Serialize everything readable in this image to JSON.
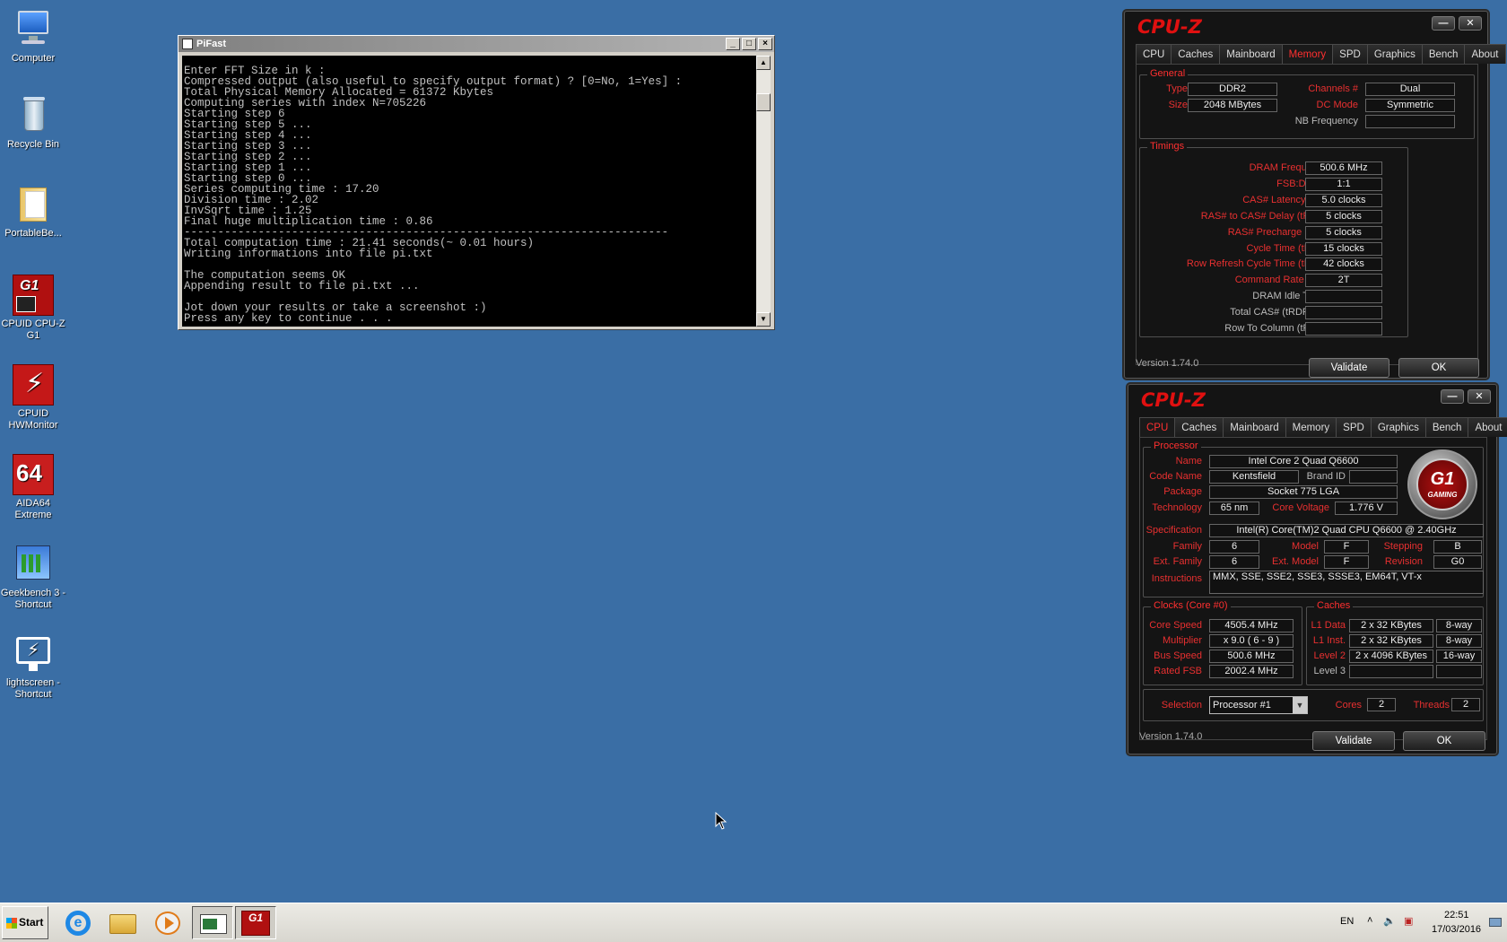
{
  "desktop": {
    "icons": [
      {
        "label": "Computer",
        "icon": "computer-icon"
      },
      {
        "label": "Recycle Bin",
        "icon": "recycle-bin-icon"
      },
      {
        "label": "PortableBe...",
        "icon": "folder-icon"
      },
      {
        "label": "CPUID CPU-Z G1",
        "icon": "cpuz-g1-icon"
      },
      {
        "label": "CPUID HWMonitor",
        "icon": "hwmonitor-icon"
      },
      {
        "label": "AIDA64 Extreme",
        "icon": "aida64-icon"
      },
      {
        "label": "Geekbench 3 - Shortcut",
        "icon": "geekbench-icon"
      },
      {
        "label": "lightscreen - Shortcut",
        "icon": "lightscreen-icon"
      }
    ]
  },
  "pifast": {
    "title": "PiFast",
    "output": "Enter FFT Size in k :\nCompressed output (also useful to specify output format) ? [0=No, 1=Yes] :\nTotal Physical Memory Allocated = 61372 Kbytes\nComputing series with index N=705226\nStarting step 6\nStarting step 5 ...\nStarting step 4 ...\nStarting step 3 ...\nStarting step 2 ...\nStarting step 1 ...\nStarting step 0 ...\nSeries computing time : 17.20\nDivision time : 2.02\nInvSqrt time : 1.25\nFinal huge multiplication time : 0.86\n------------------------------------------------------------------------\nTotal computation time : 21.41 seconds(~ 0.01 hours)\nWriting informations into file pi.txt\n\nThe computation seems OK\nAppending result to file pi.txt ...\n\nJot down your results or take a screenshot :)\nPress any key to continue . . ."
  },
  "cpuz_memory": {
    "logo": "CPU-Z",
    "tabs": [
      "CPU",
      "Caches",
      "Mainboard",
      "Memory",
      "SPD",
      "Graphics",
      "Bench",
      "About"
    ],
    "active_tab": "Memory",
    "general_title": "General",
    "type_label": "Type",
    "type_value": "DDR2",
    "size_label": "Size",
    "size_value": "2048 MBytes",
    "channels_label": "Channels #",
    "channels_value": "Dual",
    "dcmode_label": "DC Mode",
    "dcmode_value": "Symmetric",
    "nbfreq_label": "NB Frequency",
    "nbfreq_value": "",
    "timings_title": "Timings",
    "timings": [
      {
        "label": "DRAM Frequency",
        "value": "500.6 MHz",
        "red": true
      },
      {
        "label": "FSB:DRAM",
        "value": "1:1",
        "red": true
      },
      {
        "label": "CAS# Latency (CL)",
        "value": "5.0 clocks",
        "red": true
      },
      {
        "label": "RAS# to CAS# Delay (tRCD)",
        "value": "5 clocks",
        "red": true
      },
      {
        "label": "RAS# Precharge (tRP)",
        "value": "5 clocks",
        "red": true
      },
      {
        "label": "Cycle Time (tRAS)",
        "value": "15 clocks",
        "red": true
      },
      {
        "label": "Row Refresh Cycle Time (tRFC)",
        "value": "42 clocks",
        "red": true
      },
      {
        "label": "Command Rate (CR)",
        "value": "2T",
        "red": true
      },
      {
        "label": "DRAM Idle Timer",
        "value": "",
        "red": false
      },
      {
        "label": "Total CAS# (tRDRAM)",
        "value": "",
        "red": false
      },
      {
        "label": "Row To Column (tRCD)",
        "value": "",
        "red": false
      }
    ],
    "version": "Version 1.74.0",
    "validate": "Validate",
    "ok": "OK"
  },
  "cpuz_cpu": {
    "logo": "CPU-Z",
    "tabs": [
      "CPU",
      "Caches",
      "Mainboard",
      "Memory",
      "SPD",
      "Graphics",
      "Bench",
      "About"
    ],
    "active_tab": "CPU",
    "processor_title": "Processor",
    "name_label": "Name",
    "name_value": "Intel Core 2 Quad Q6600",
    "codename_label": "Code Name",
    "codename_value": "Kentsfield",
    "brandid_label": "Brand ID",
    "brandid_value": "",
    "package_label": "Package",
    "package_value": "Socket 775 LGA",
    "technology_label": "Technology",
    "technology_value": "65 nm",
    "corevoltage_label": "Core Voltage",
    "corevoltage_value": "1.776 V",
    "spec_label": "Specification",
    "spec_value": "Intel(R) Core(TM)2 Quad CPU    Q6600  @ 2.40GHz",
    "family_label": "Family",
    "family_value": "6",
    "model_label": "Model",
    "model_value": "F",
    "stepping_label": "Stepping",
    "stepping_value": "B",
    "extfamily_label": "Ext. Family",
    "extfamily_value": "6",
    "extmodel_label": "Ext. Model",
    "extmodel_value": "F",
    "revision_label": "Revision",
    "revision_value": "G0",
    "instructions_label": "Instructions",
    "instructions_value": "MMX, SSE, SSE2, SSE3, SSSE3, EM64T, VT-x",
    "badge_main": "G1",
    "badge_sub": "GAMING",
    "clocks_title": "Clocks (Core #0)",
    "corespeed_label": "Core Speed",
    "corespeed_value": "4505.4 MHz",
    "multiplier_label": "Multiplier",
    "multiplier_value": "x 9.0 ( 6 - 9 )",
    "busspeed_label": "Bus Speed",
    "busspeed_value": "500.6 MHz",
    "ratedfsb_label": "Rated FSB",
    "ratedfsb_value": "2002.4 MHz",
    "caches_title": "Caches",
    "l1data_label": "L1 Data",
    "l1data_value": "2 x 32 KBytes",
    "l1data_way": "8-way",
    "l1inst_label": "L1 Inst.",
    "l1inst_value": "2 x 32 KBytes",
    "l1inst_way": "8-way",
    "level2_label": "Level 2",
    "level2_value": "2 x 4096 KBytes",
    "level2_way": "16-way",
    "level3_label": "Level 3",
    "level3_value": "",
    "level3_way": "",
    "selection_label": "Selection",
    "selection_value": "Processor #1",
    "cores_label": "Cores",
    "cores_value": "2",
    "threads_label": "Threads",
    "threads_value": "2",
    "version": "Version 1.74.0",
    "validate": "Validate",
    "ok": "OK"
  },
  "taskbar": {
    "start_label": "Start",
    "language": "EN",
    "time": "22:51",
    "date": "17/03/2016"
  }
}
